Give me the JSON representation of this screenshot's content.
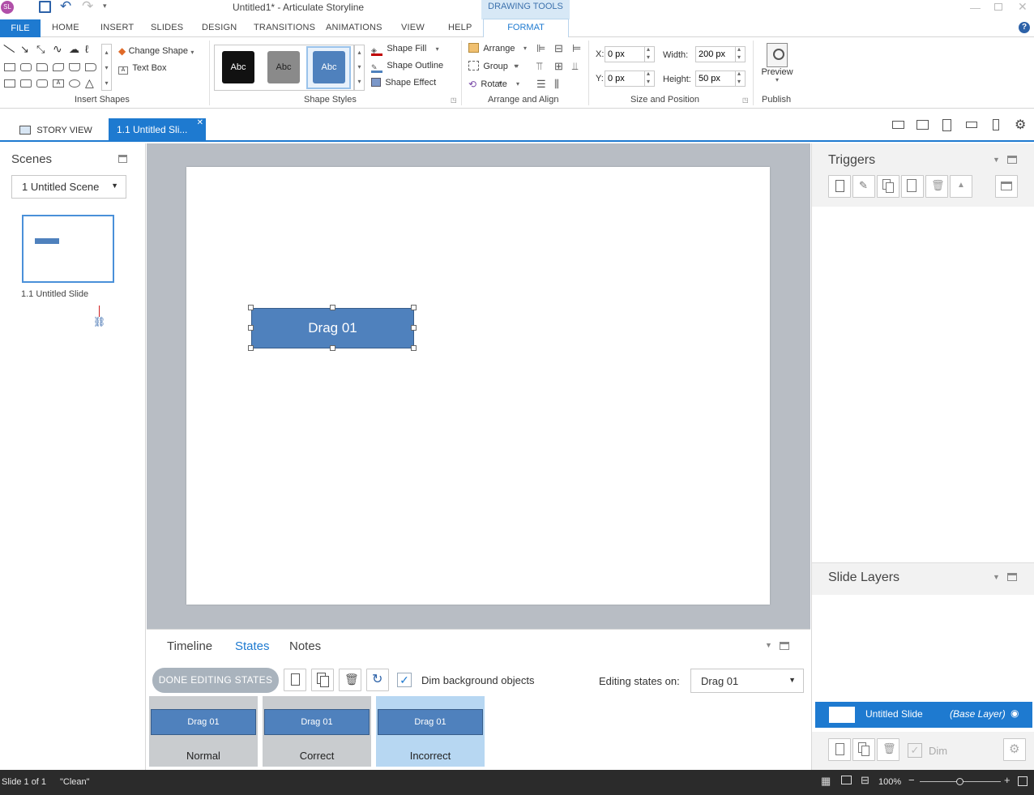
{
  "window": {
    "app_icon": "SL",
    "title": "Untitled1* -  Articulate Storyline",
    "context_tab_group": "DRAWING TOOLS"
  },
  "menu": {
    "file": "FILE",
    "items": [
      "HOME",
      "INSERT",
      "SLIDES",
      "DESIGN",
      "TRANSITIONS",
      "ANIMATIONS",
      "VIEW",
      "HELP"
    ],
    "active": "FORMAT"
  },
  "ribbon": {
    "insert_shapes": {
      "change_shape": "Change Shape",
      "text_box": "Text Box",
      "label": "Insert Shapes"
    },
    "shape_styles": {
      "samples": [
        "Abc",
        "Abc",
        "Abc"
      ],
      "fill": "Shape Fill",
      "outline": "Shape Outline",
      "effect": "Shape Effect",
      "label": "Shape Styles"
    },
    "arrange": {
      "arrange": "Arrange",
      "group": "Group",
      "rotate": "Rotate",
      "label": "Arrange and Align"
    },
    "size": {
      "x_label": "X:",
      "x_value": "0 px",
      "y_label": "Y:",
      "y_value": "0 px",
      "width_label": "Width:",
      "width_value": "200 px",
      "height_label": "Height:",
      "height_value": "50 px",
      "label": "Size and Position"
    },
    "publish": {
      "preview": "Preview",
      "label": "Publish"
    }
  },
  "tabs": {
    "story_view": "STORY VIEW",
    "slide_tab": "1.1 Untitled Sli..."
  },
  "scenes": {
    "title": "Scenes",
    "dropdown": "1 Untitled Scene",
    "slide_label": "1.1 Untitled Slide"
  },
  "slide": {
    "shape_text": "Drag 01"
  },
  "bottom": {
    "tabs": [
      "Timeline",
      "States",
      "Notes"
    ],
    "active_tab": "States",
    "done_button": "DONE EDITING STATES",
    "dim_label": "Dim background objects",
    "editing_label": "Editing states on:",
    "editing_value": "Drag 01",
    "states": [
      {
        "thumb": "Drag 01",
        "name": "Normal"
      },
      {
        "thumb": "Drag 01",
        "name": "Correct"
      },
      {
        "thumb": "Drag 01",
        "name": "Incorrect"
      }
    ]
  },
  "right": {
    "triggers_title": "Triggers",
    "layers_title": "Slide Layers",
    "layer_name": "Untitled Slide",
    "layer_tag": "(Base Layer)",
    "dim_label": "Dim"
  },
  "status": {
    "slide": "Slide 1 of 1",
    "theme": "\"Clean\"",
    "zoom": "100%"
  },
  "colors": {
    "accent": "#1e7ad0",
    "shape": "#4f81bd",
    "context_tab": "#d7e8f6"
  }
}
